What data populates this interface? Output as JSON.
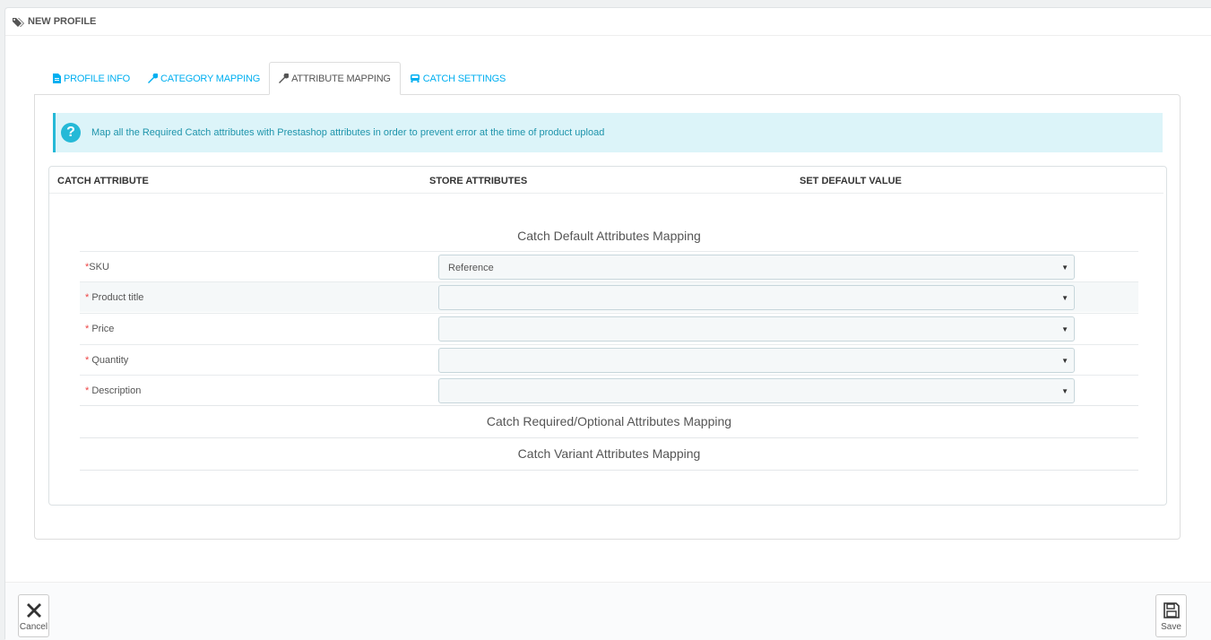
{
  "panel": {
    "title": "NEW PROFILE",
    "title_icon": "tags-icon"
  },
  "tabs": [
    {
      "label": "PROFILE INFO",
      "icon": "file-icon",
      "active": false
    },
    {
      "label": "CATEGORY MAPPING",
      "icon": "wrench-icon",
      "active": false
    },
    {
      "label": "ATTRIBUTE MAPPING",
      "icon": "wrench-icon",
      "active": true
    },
    {
      "label": "CATCH SETTINGS",
      "icon": "car-icon",
      "active": false
    }
  ],
  "alert": {
    "icon": "question-circle-icon",
    "text": "Map all the Required Catch attributes with Prestashop attributes in order to prevent error at the time of product upload"
  },
  "table": {
    "headers": [
      "CATCH ATTRIBUTE",
      "STORE ATTRIBUTES",
      "SET DEFAULT VALUE"
    ],
    "sections": {
      "default": "Catch Default Attributes Mapping",
      "required_optional": "Catch Required/Optional Attributes Mapping",
      "variant": "Catch Variant Attributes Mapping"
    },
    "rows": [
      {
        "required_mark": "*",
        "label": "SKU",
        "value": "Reference"
      },
      {
        "required_mark": "* ",
        "label": "Product title",
        "value": ""
      },
      {
        "required_mark": "* ",
        "label": "Price",
        "value": ""
      },
      {
        "required_mark": "* ",
        "label": "Quantity",
        "value": ""
      },
      {
        "required_mark": "* ",
        "label": "Description",
        "value": ""
      }
    ]
  },
  "footer": {
    "cancel": {
      "label": "Cancel",
      "icon": "close-icon"
    },
    "save": {
      "label": "Save",
      "icon": "floppy-disk-icon"
    }
  },
  "colors": {
    "accent": "#00aff0",
    "alert_bg": "#dcf4f9",
    "alert_border": "#25b9d7",
    "required": "#e44444"
  }
}
